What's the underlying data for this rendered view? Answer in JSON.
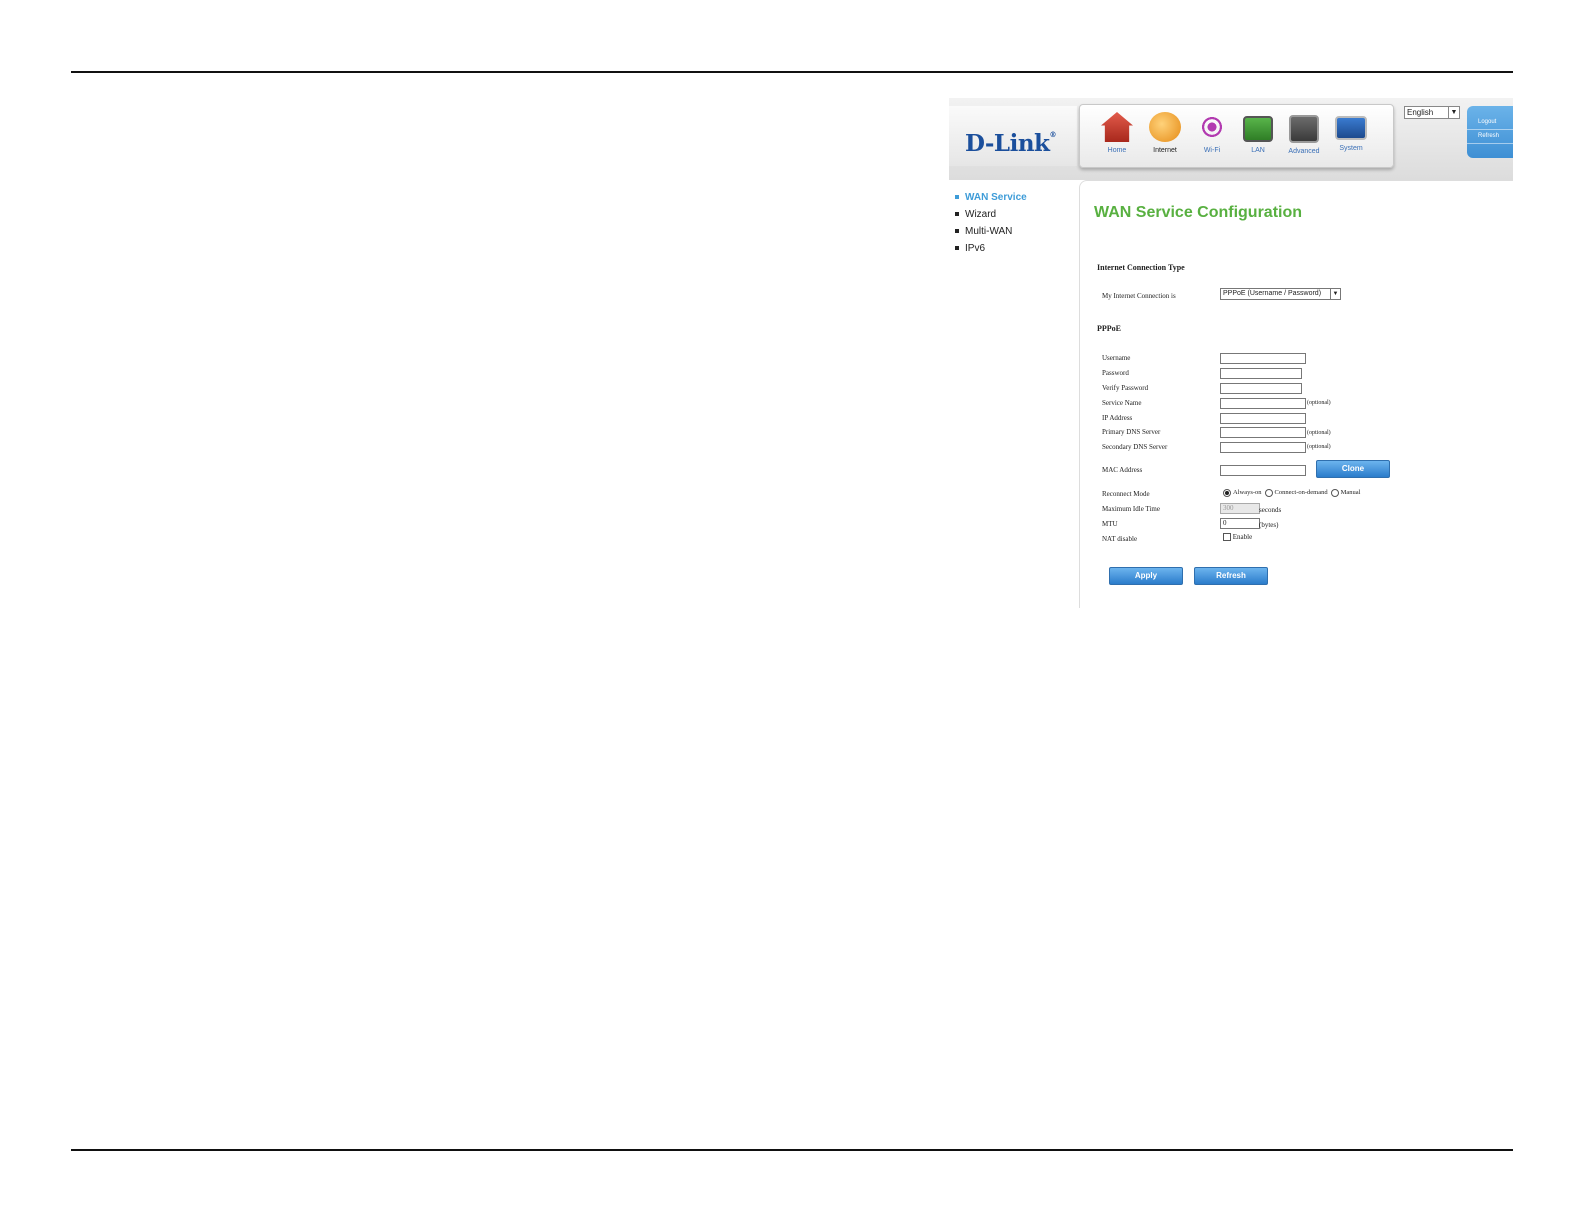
{
  "brand": "D-Link",
  "nav": [
    {
      "label": "Home",
      "icon": "home-icon"
    },
    {
      "label": "Internet",
      "icon": "internet-globe-icon"
    },
    {
      "label": "Wi-Fi",
      "icon": "wifi-antenna-icon"
    },
    {
      "label": "LAN",
      "icon": "lan-port-icon"
    },
    {
      "label": "Advanced",
      "icon": "tools-icon"
    },
    {
      "label": "System",
      "icon": "monitor-icon"
    }
  ],
  "language": "English",
  "side_panel": {
    "logout": "Logout",
    "refresh": "Refresh"
  },
  "menu": [
    "WAN Service",
    "Wizard",
    "Multi-WAN",
    "IPv6"
  ],
  "page_title": "WAN Service Configuration",
  "connection_type": {
    "heading": "Internet Connection Type",
    "label": "My Internet Connection is",
    "value": "PPPoE (Username / Password)"
  },
  "pppoe": {
    "heading": "PPPoE",
    "fields": {
      "username": "Username",
      "password": "Password",
      "verify_password": "Verify Password",
      "service_name": "Service Name",
      "ip_address": "IP Address",
      "primary_dns": "Primary DNS Server",
      "secondary_dns": "Secondary DNS Server",
      "mac_address": "MAC Address",
      "reconnect_mode": "Reconnect Mode",
      "max_idle_time": "Maximum Idle Time",
      "mtu": "MTU",
      "nat_disable": "NAT disable"
    },
    "optional_note": "(optional)",
    "clone_button": "Clone",
    "reconnect_options": [
      "Always-on",
      "Connect-on-demand",
      "Manual"
    ],
    "reconnect_selected": "Always-on",
    "idle_time_value": "300",
    "idle_time_unit": "seconds",
    "mtu_value": "0",
    "mtu_unit": "(bytes)",
    "nat_checkbox_label": "Enable"
  },
  "buttons": {
    "apply": "Apply",
    "refresh": "Refresh"
  },
  "colors": {
    "title_green": "#58b040",
    "accent_blue": "#3e9cd8",
    "brand_blue": "#1b4f9c"
  }
}
